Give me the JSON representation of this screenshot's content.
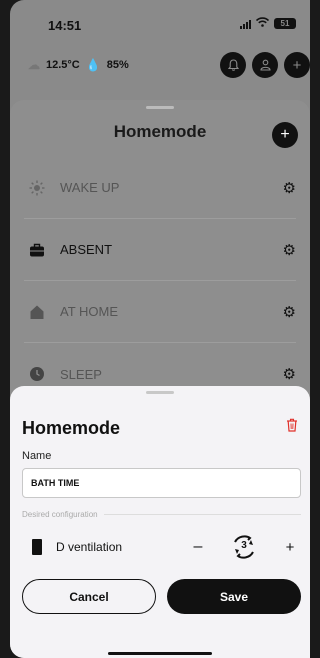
{
  "status_bar": {
    "time": "14:51",
    "battery": "51"
  },
  "weather": {
    "temperature": "12.5°C",
    "humidity": "85%"
  },
  "homemode_sheet": {
    "title": "Homemode",
    "modes": [
      {
        "label": "WAKE UP",
        "icon": "sun-icon"
      },
      {
        "label": "ABSENT",
        "icon": "briefcase-icon",
        "active": true
      },
      {
        "label": "AT HOME",
        "icon": "house-icon"
      },
      {
        "label": "SLEEP",
        "icon": "moon-icon"
      }
    ]
  },
  "edit_sheet": {
    "title": "Homemode",
    "name_label": "Name",
    "name_value": "BATH TIME",
    "desired_label": "Desired configuration",
    "device": {
      "label": "D ventilation",
      "level": "3"
    },
    "cancel_label": "Cancel",
    "save_label": "Save"
  },
  "colors": {
    "delete": "#e0302a",
    "accent": "#111111"
  }
}
